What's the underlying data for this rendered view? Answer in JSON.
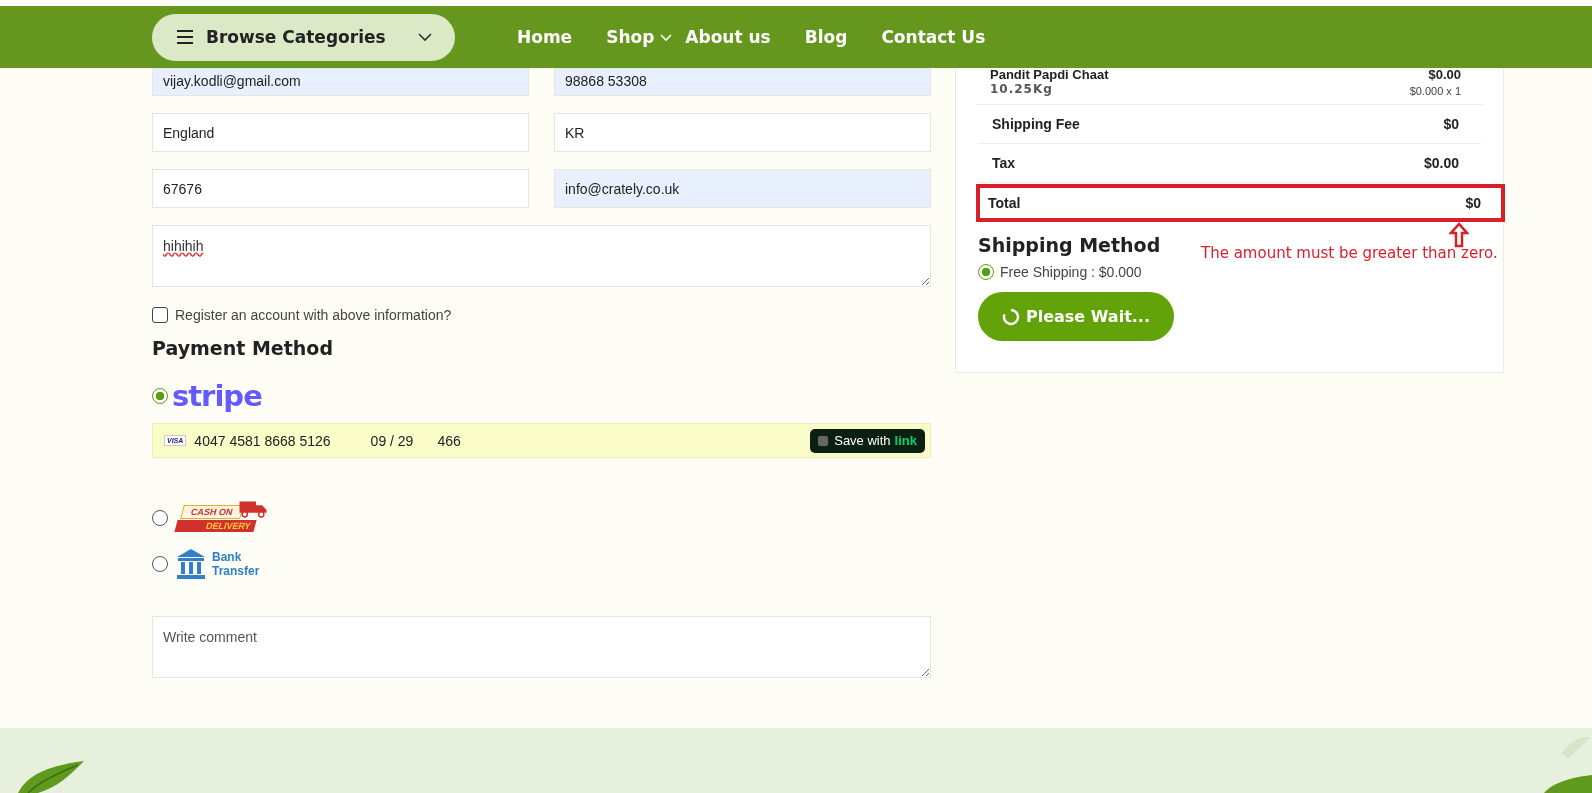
{
  "header": {
    "browse": {
      "label": "Browse Categories"
    },
    "nav": [
      {
        "label": "Home",
        "dropdown": false
      },
      {
        "label": "Shop",
        "dropdown": true
      },
      {
        "label": "About us",
        "dropdown": false
      },
      {
        "label": "Blog",
        "dropdown": false
      },
      {
        "label": "Contact Us",
        "dropdown": false
      }
    ]
  },
  "billing_fields": [
    [
      {
        "value": "vijay.kodli@gmail.com",
        "autofilled": true
      },
      {
        "value": "98868 53308",
        "autofilled": true
      }
    ],
    [
      {
        "value": "England",
        "autofilled": false
      },
      {
        "value": "KR",
        "autofilled": false
      }
    ],
    [
      {
        "value": "67676",
        "autofilled": false
      },
      {
        "value": "info@crately.co.uk",
        "autofilled": true
      }
    ]
  ],
  "notes": {
    "value": "hihihih"
  },
  "register": {
    "label": "Register an account with above information?",
    "checked": false
  },
  "payment": {
    "title": "Payment Method",
    "methods": [
      {
        "kind": "stripe",
        "label": "stripe",
        "selected": true
      },
      {
        "kind": "cod",
        "line_1": "CASH ON",
        "line_2": "DELIVERY",
        "selected": false
      },
      {
        "kind": "bank",
        "line_1": "Bank",
        "line_2": "Transfer",
        "selected": false
      }
    ],
    "card": {
      "brand": "VISA",
      "number": "4047 4581 8668 5126",
      "expiry": "09 / 29",
      "cvc": "466",
      "save": {
        "label": "Save with",
        "brand": "link",
        "checked": false
      }
    }
  },
  "comment": {
    "placeholder": "Write comment"
  },
  "summary": {
    "product": {
      "name": "Pandit Papdi Chaat",
      "weight": "10.25Kg",
      "price": "$0.00",
      "qty": "$0.000 x 1"
    },
    "rows": [
      {
        "label": "Shipping Fee",
        "value": "$0",
        "highlighted": false
      },
      {
        "label": "Tax",
        "value": "$0.00",
        "highlighted": false
      },
      {
        "label": "Total",
        "value": "$0",
        "highlighted": true
      }
    ]
  },
  "annotation": {
    "text": "The amount must be greater than zero."
  },
  "shipping": {
    "title": "Shipping Method",
    "options": [
      {
        "label": "Free Shipping : $0.000",
        "selected": true
      }
    ]
  },
  "submit": {
    "label": "Please Wait...",
    "loading": true
  }
}
